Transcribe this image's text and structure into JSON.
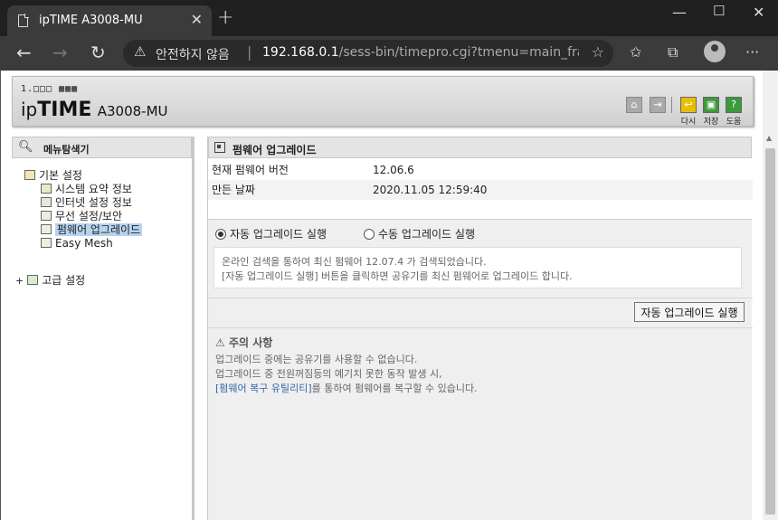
{
  "browser": {
    "tab_title": "ipTIME A3008-MU",
    "security_label": "안전하지 않음",
    "url_host": "192.168.0.1",
    "url_path": "/sess-bin/timepro.cgi?tmenu=main_fra..."
  },
  "header": {
    "logo_dots": "1.□□□ ▦▦▦",
    "logo_ip": "ip",
    "logo_time": "TIME",
    "logo_model": "A3008-MU",
    "btn_back": "다시",
    "btn_save": "저장",
    "btn_help": "도움"
  },
  "sidebar": {
    "title": "메뉴탐색기",
    "basic": "기본 설정",
    "items": [
      {
        "label": "시스템 요약 정보"
      },
      {
        "label": "인터넷 설정 정보"
      },
      {
        "label": "무선 설정/보안"
      },
      {
        "label": "펌웨어 업그레이드"
      },
      {
        "label": "Easy Mesh"
      }
    ],
    "advanced": "고급 설정",
    "expand_symbol": "+"
  },
  "main": {
    "title": "펌웨어 업그레이드",
    "info": [
      {
        "key": "현재 펌웨어 버전",
        "value": "12.06.6"
      },
      {
        "key": "만든 날짜",
        "value": "2020.11.05 12:59:40"
      }
    ],
    "radio_auto": "자동 업그레이드 실행",
    "radio_manual": "수동 업그레이드 실행",
    "msg_line1": "온라인 검색을 통하여 최신 펌웨어 12.07.4 가 검색되었습니다.",
    "msg_line2": "[자동 업그레이드 실행] 버튼을 클릭하면 공유기를 최신 펌웨어로 업그레이드 합니다.",
    "button": "자동 업그레이드 실행",
    "notice_title": "주의 사항",
    "notice_line1": "업그레이드 중에는 공유기를 사용할 수 없습니다.",
    "notice_line2": "업그레이드 중 전원꺼짐등의 예기치 못한 동작 발생 시,",
    "notice_link": "[펌웨어 복구 유틸리티]",
    "notice_line3": "를 통하여 펌웨어를 복구할 수 있습니다."
  },
  "colors": {
    "selection": "#b6d4f0",
    "link": "#3366aa",
    "save_green": "#3c9a3c",
    "back_yellow": "#e6c000"
  }
}
